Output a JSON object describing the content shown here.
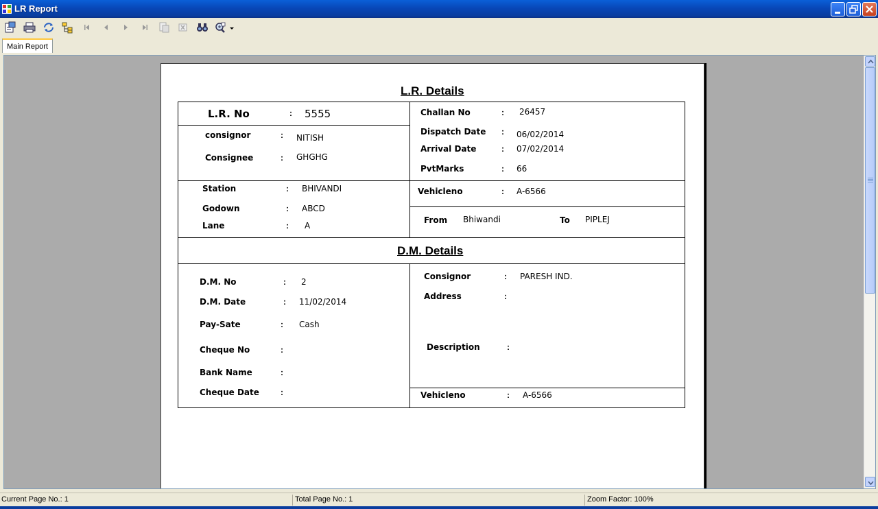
{
  "window": {
    "title": "LR Report"
  },
  "tabs": [
    {
      "label": "Main Report"
    }
  ],
  "report": {
    "lr_section_title": "L.R. Details",
    "lr_no": {
      "label": "L.R. No",
      "value": "5555"
    },
    "consignor": {
      "label": "consignor",
      "value": "NITISH"
    },
    "consignee": {
      "label": "Consignee",
      "value": "GHGHG"
    },
    "challan_no": {
      "label": "Challan No",
      "value": "26457"
    },
    "dispatch_date": {
      "label": "Dispatch Date",
      "value": "06/02/2014"
    },
    "arrival_date": {
      "label": "Arrival Date",
      "value": "07/02/2014"
    },
    "pvt_marks": {
      "label": "PvtMarks",
      "value": "66"
    },
    "station": {
      "label": "Station",
      "value": "BHIVANDI"
    },
    "godown": {
      "label": "Godown",
      "value": "ABCD"
    },
    "lane": {
      "label": "Lane",
      "value": "A"
    },
    "vehicle_no_lr": {
      "label": "Vehicleno",
      "value": "A-6566"
    },
    "from": {
      "label": "From",
      "value": "Bhiwandi"
    },
    "to": {
      "label": "To",
      "value": "PIPLEJ"
    },
    "dm_section_title": "D.M. Details",
    "dm_no": {
      "label": "D.M. No",
      "value": "2"
    },
    "dm_date": {
      "label": "D.M. Date",
      "value": "11/02/2014"
    },
    "pay_sate": {
      "label": "Pay-Sate",
      "value": "Cash"
    },
    "cheque_no": {
      "label": "Cheque No",
      "value": ""
    },
    "bank_name": {
      "label": "Bank Name",
      "value": ""
    },
    "cheque_date": {
      "label": "Cheque Date",
      "value": ""
    },
    "dm_consignor": {
      "label": "Consignor",
      "value": "PARESH IND."
    },
    "address": {
      "label": "Address",
      "value": ""
    },
    "description": {
      "label": "Description",
      "value": ""
    },
    "vehicle_no_dm": {
      "label": "Vehicleno",
      "value": "A-6566"
    },
    "colon": ":"
  },
  "statusbar": {
    "current_page": "Current Page No.: 1",
    "total_page": "Total Page No.: 1",
    "zoom": "Zoom Factor: 100%"
  },
  "colors": {
    "titlebar": "#0a3d9e",
    "tab_accent": "#ffc83c",
    "viewer_bg": "#ababab"
  }
}
